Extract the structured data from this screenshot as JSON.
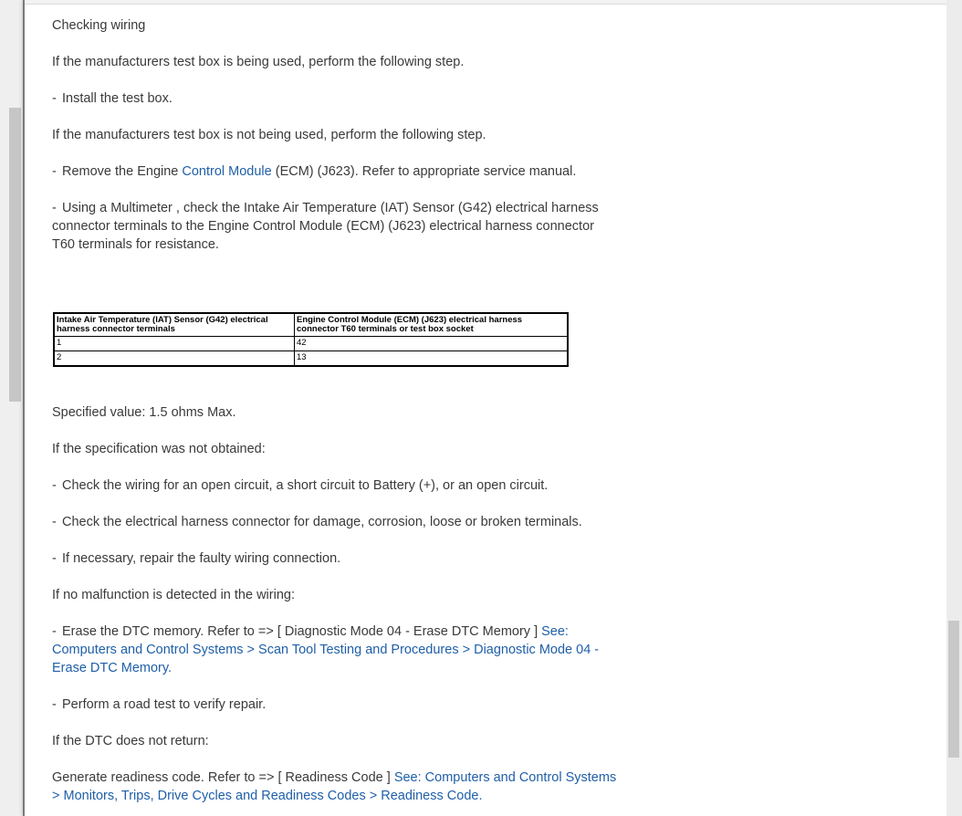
{
  "doc": {
    "heading": "Checking wiring",
    "p1": "If the manufacturers test box is being used, perform the following step.",
    "b1": "Install the test box.",
    "p2": "If the manufacturers test box is not being used, perform the following step.",
    "b2_pre": "Remove the Engine ",
    "b2_link": "Control Module",
    "b2_post": " (ECM) (J623). Refer to appropriate service manual.",
    "b3": "Using a Multimeter , check the Intake Air Temperature (IAT) Sensor (G42) electrical harness connector terminals to the Engine Control Module (ECM) (J623) electrical harness connector T60 terminals for resistance.",
    "table": {
      "headers": [
        "Intake Air Temperature (IAT) Sensor (G42) electrical harness connector terminals",
        "Engine Control Module (ECM) (J623) electrical harness connector T60 terminals or test box socket"
      ],
      "rows": [
        [
          "1",
          "42"
        ],
        [
          "2",
          "13"
        ]
      ]
    },
    "spec": "Specified value: 1.5 ohms Max.",
    "p3": "If the specification was not obtained:",
    "b4": "Check the wiring for an open circuit, a short circuit to Battery (+), or an open circuit.",
    "b5": "Check the electrical harness connector for damage, corrosion, loose or broken terminals.",
    "b6": "If necessary, repair the faulty wiring connection.",
    "p4": "If no malfunction is detected in the wiring:",
    "b7_pre": "Erase the DTC memory. Refer to => [ Diagnostic Mode 04 - Erase DTC Memory ] ",
    "b7_link": "See: Computers and Control Systems > Scan Tool Testing and Procedures > Diagnostic Mode 04 - Erase DTC Memory.",
    "b8": "Perform a road test to verify repair.",
    "p5": "If the DTC does not return:",
    "p6_pre": "Generate readiness code. Refer to => [ Readiness Code ] ",
    "p6_link": "See: Computers and Control Systems > Monitors, Trips, Drive Cycles and Readiness Codes > Readiness Code."
  },
  "bullet_char": "-",
  "colors": {
    "link": "#1f5fa8",
    "text": "#3a3a3a",
    "page_bg": "#ffffff",
    "chrome_bg": "#ececec"
  }
}
